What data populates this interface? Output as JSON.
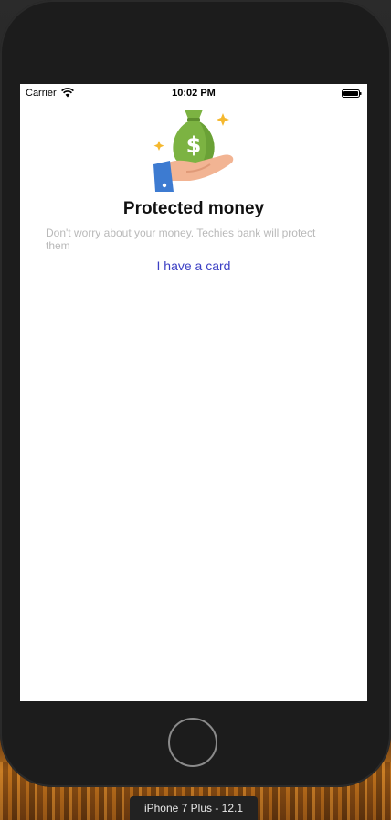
{
  "status_bar": {
    "carrier": "Carrier",
    "time": "10:02 PM",
    "wifi_icon": "wifi-icon",
    "battery_icon": "battery-icon"
  },
  "onboarding": {
    "illustration_icon": "money-bag-in-hand-icon",
    "title": "Protected money",
    "description": "Don't worry about your money. Techies bank will protect them",
    "card_link": "I have a card"
  },
  "simulator": {
    "device_label": "iPhone 7 Plus - 12.1"
  },
  "colors": {
    "accent": "#3b3fc4",
    "bag_green": "#7cb342",
    "description_gray": "#b9b9b9"
  }
}
